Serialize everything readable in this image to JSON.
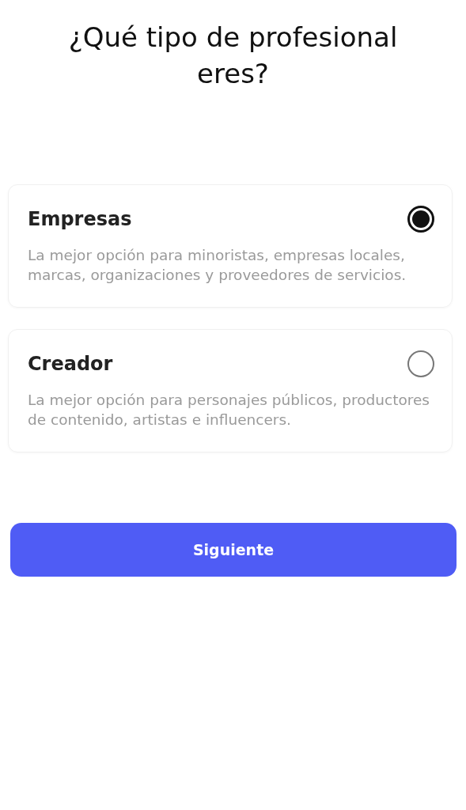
{
  "title": "¿Qué tipo de profesional eres?",
  "options": [
    {
      "label": "Empresas",
      "description": "La mejor opción para minoristas, empresas locales, marcas, organizaciones y proveedores de servicios.",
      "selected": true
    },
    {
      "label": "Creador",
      "description": "La mejor opción para personajes públicos, productores de contenido, artistas e influencers.",
      "selected": false
    }
  ],
  "next_button": {
    "label": "Siguiente"
  }
}
